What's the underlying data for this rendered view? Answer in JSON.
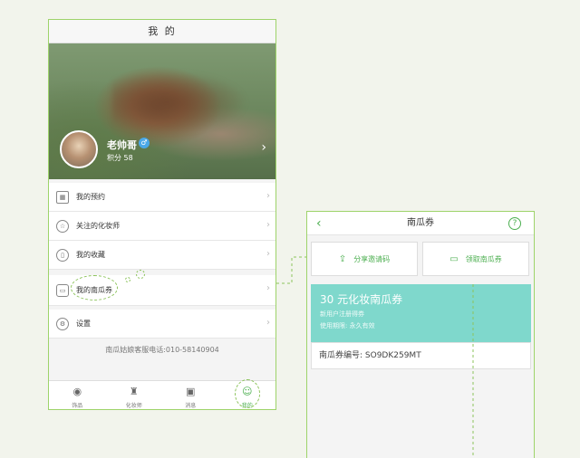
{
  "left_screen": {
    "title": "我 的",
    "user": {
      "name": "老帅哥",
      "gender_symbol": "♂",
      "points": "积分 58"
    },
    "menu": [
      {
        "label": "我的预约",
        "icon": "calendar-icon"
      },
      {
        "label": "关注的化妆师",
        "icon": "star-icon"
      },
      {
        "label": "我的收藏",
        "icon": "bottle-icon"
      },
      {
        "label": "我的南瓜券",
        "icon": "coupon-icon"
      },
      {
        "label": "设置",
        "icon": "gear-icon"
      }
    ],
    "hotline": "南瓜姑娘客服电话:010-58140904",
    "tabs": [
      {
        "label": "饰品",
        "icon": "accessory-icon"
      },
      {
        "label": "化妆师",
        "icon": "makeup-artist-icon"
      },
      {
        "label": "消息",
        "icon": "message-icon"
      },
      {
        "label": "我的",
        "icon": "profile-icon"
      }
    ]
  },
  "right_screen": {
    "title": "南瓜券",
    "share_label": "分享邀请码",
    "claim_label": "领取南瓜券",
    "coupon": {
      "title": "30 元化妆南瓜券",
      "subtitle": "新用户注册得券",
      "validity": "使用期限: 永久有效"
    },
    "coupon_code": "南瓜券编号: SO9DK259MT"
  },
  "colors": {
    "accent": "#4caf50",
    "coupon_bg": "#7fd8cc",
    "frame": "#9ed36a"
  }
}
